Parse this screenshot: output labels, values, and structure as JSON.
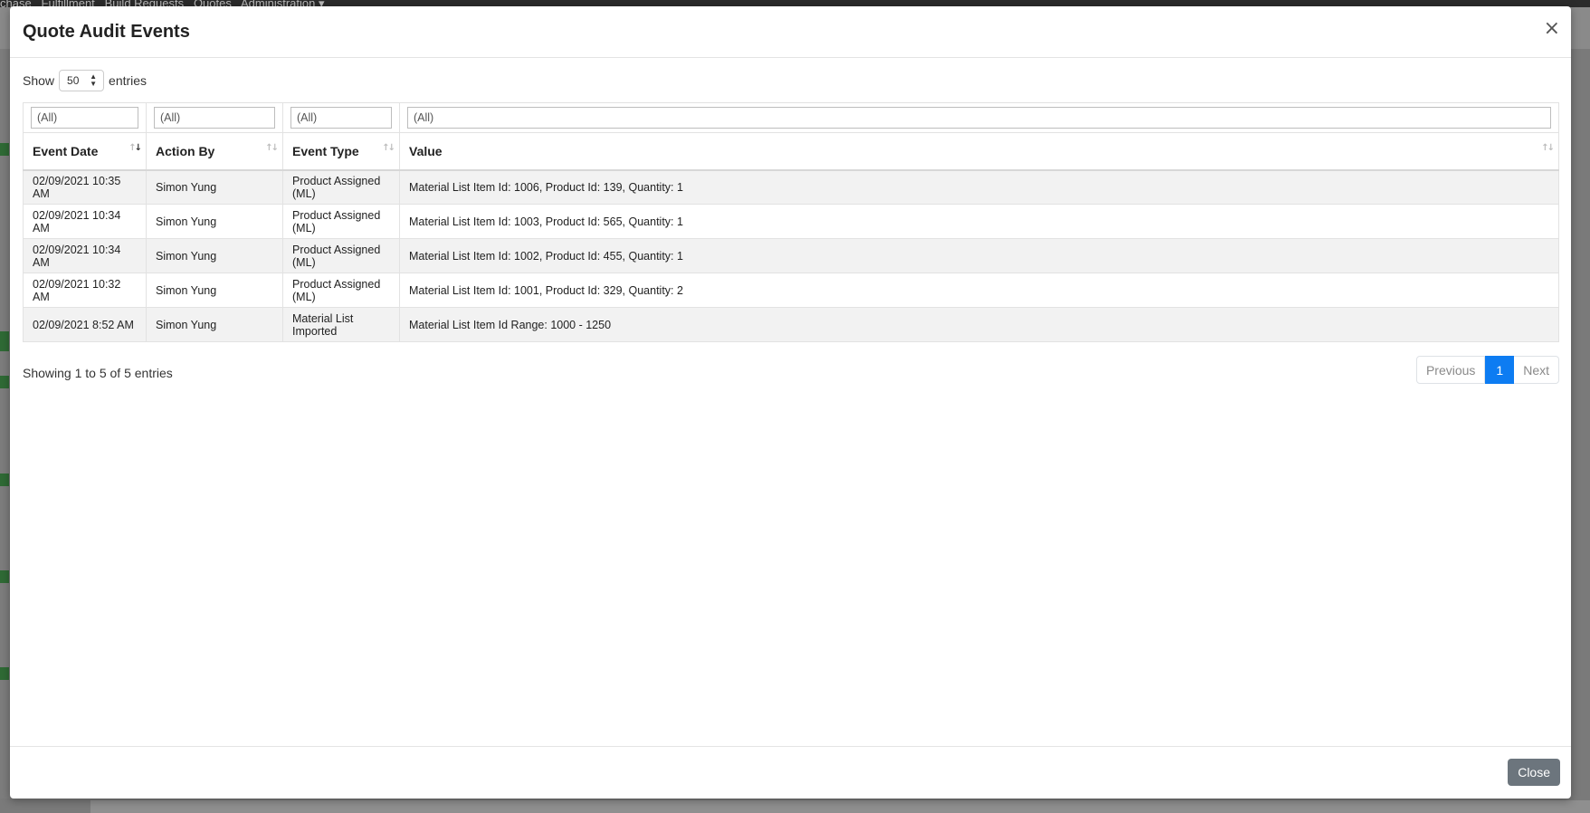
{
  "background": {
    "nav_items": [
      "chase",
      "Fulfillment",
      "Build Requests",
      "Quotes",
      "Administration ▾"
    ]
  },
  "modal": {
    "title": "Quote Audit Events",
    "close_icon": "×",
    "length": {
      "prefix": "Show",
      "value": "50",
      "suffix": "entries"
    },
    "filters": [
      "(All)",
      "(All)",
      "(All)",
      "(All)"
    ],
    "columns": [
      "Event Date",
      "Action By",
      "Event Type",
      "Value"
    ],
    "rows": [
      {
        "date": "02/09/2021 10:35 AM",
        "by": "Simon Yung",
        "type": "Product Assigned (ML)",
        "value": "Material List Item Id: 1006, Product Id: 139, Quantity: 1"
      },
      {
        "date": "02/09/2021 10:34 AM",
        "by": "Simon Yung",
        "type": "Product Assigned (ML)",
        "value": "Material List Item Id: 1003, Product Id: 565, Quantity: 1"
      },
      {
        "date": "02/09/2021 10:34 AM",
        "by": "Simon Yung",
        "type": "Product Assigned (ML)",
        "value": "Material List Item Id: 1002, Product Id: 455, Quantity: 1"
      },
      {
        "date": "02/09/2021 10:32 AM",
        "by": "Simon Yung",
        "type": "Product Assigned (ML)",
        "value": "Material List Item Id: 1001, Product Id: 329, Quantity: 2"
      },
      {
        "date": "02/09/2021 8:52 AM",
        "by": "Simon Yung",
        "type": "Material List Imported",
        "value": "Material List Item Id Range: 1000 - 1250"
      }
    ],
    "info": "Showing 1 to 5 of 5 entries",
    "pagination": {
      "previous": "Previous",
      "current": "1",
      "next": "Next"
    },
    "footer": {
      "close_label": "Close"
    },
    "colors": {
      "accent": "#0d7cf2",
      "close_button": "#6c757d"
    }
  }
}
